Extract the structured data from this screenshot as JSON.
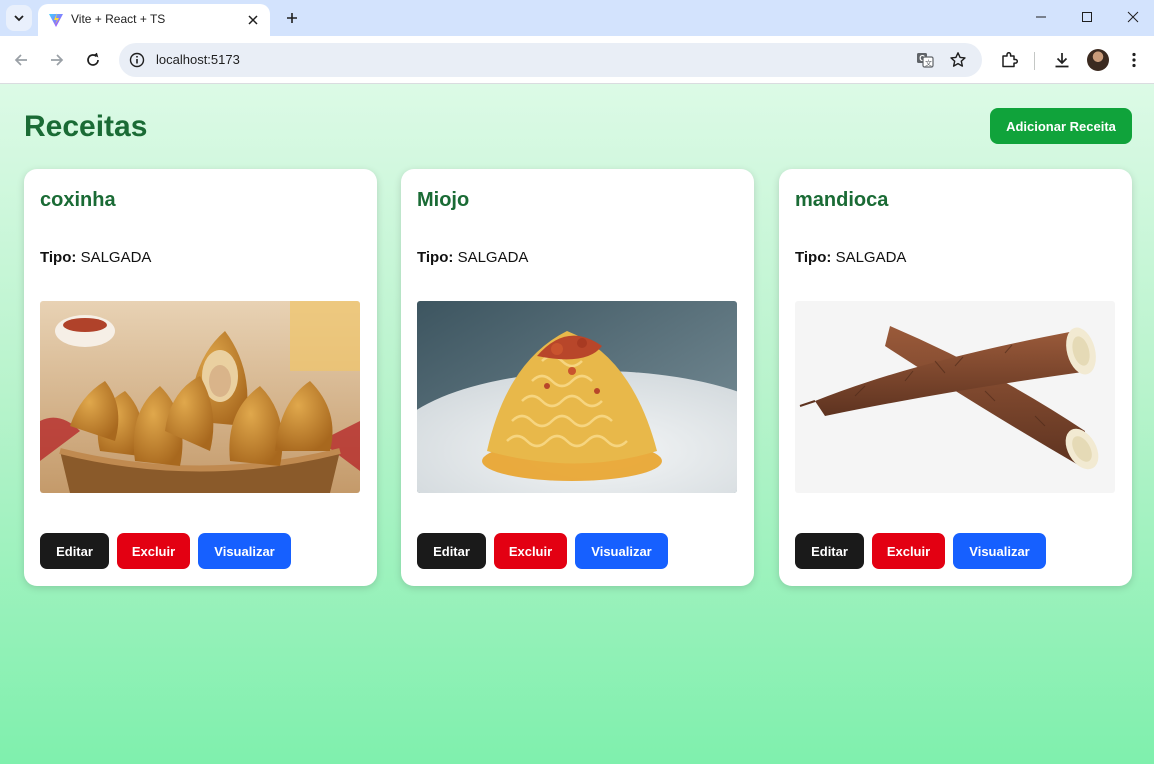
{
  "browser": {
    "tab_title": "Vite + React + TS",
    "url": "localhost:5173"
  },
  "page": {
    "title": "Receitas",
    "add_button": "Adicionar Receita"
  },
  "recipes": [
    {
      "name": "coxinha",
      "type_label": "Tipo:",
      "type": "SALGADA",
      "image": "coxinha-photo"
    },
    {
      "name": "Miojo",
      "type_label": "Tipo:",
      "type": "SALGADA",
      "image": "noodles-photo"
    },
    {
      "name": "mandioca",
      "type_label": "Tipo:",
      "type": "SALGADA",
      "image": "cassava-photo"
    }
  ],
  "actions": {
    "edit": "Editar",
    "delete": "Excluir",
    "view": "Visualizar"
  },
  "colors": {
    "title_green": "#1a6b35",
    "add_button": "#10a33b",
    "edit_button": "#1a1a1a",
    "delete_button": "#e30012",
    "view_button": "#1660ff"
  }
}
